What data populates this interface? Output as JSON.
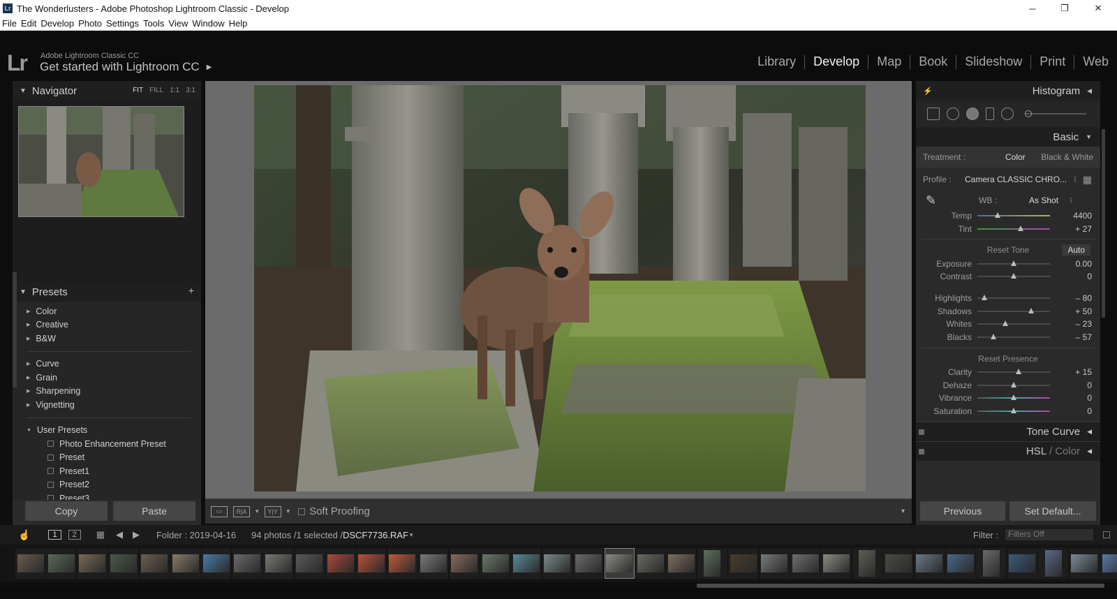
{
  "window": {
    "title": "The Wonderlusters - Adobe Photoshop Lightroom Classic - Develop",
    "app_icon": "Lr",
    "min": "─",
    "max": "❐",
    "close": "✕"
  },
  "menu": [
    "File",
    "Edit",
    "Develop",
    "Photo",
    "Settings",
    "Tools",
    "View",
    "Window",
    "Help"
  ],
  "identity": {
    "logo": "Lr",
    "sub": "Adobe Lightroom Classic CC",
    "main": "Get started with Lightroom CC",
    "arrow": "▶"
  },
  "modules": [
    "Library",
    "Develop",
    "Map",
    "Book",
    "Slideshow",
    "Print",
    "Web"
  ],
  "active_module": "Develop",
  "navigator": {
    "title": "Navigator",
    "options": [
      "FIT",
      "FILL",
      "1:1",
      "3:1"
    ],
    "active_option": "FIT"
  },
  "presets": {
    "title": "Presets",
    "add": "+",
    "groups_a": [
      "Color",
      "Creative",
      "B&W"
    ],
    "groups_b": [
      "Curve",
      "Grain",
      "Sharpening",
      "Vignetting"
    ],
    "user_group": "User Presets",
    "user_items": [
      "Photo Enhancement Preset",
      "Preset",
      "Preset1",
      "Preset2",
      "Preset3"
    ]
  },
  "left_buttons": {
    "copy": "Copy",
    "paste": "Paste"
  },
  "toolbar": {
    "soft_proofing": "Soft Proofing"
  },
  "right": {
    "histogram": "Histogram",
    "basic": "Basic",
    "treatment_label": "Treatment :",
    "treatment_color": "Color",
    "treatment_bw": "Black & White",
    "profile_label": "Profile :",
    "profile_value": "Camera CLASSIC CHRO...",
    "wb_label": "WB :",
    "wb_value": "As Shot",
    "reset_tone": "Reset Tone",
    "auto": "Auto",
    "reset_presence": "Reset Presence",
    "sliders": {
      "temp": {
        "label": "Temp",
        "value": "4400",
        "pos": 0.28
      },
      "tint": {
        "label": "Tint",
        "value": "+ 27",
        "pos": 0.6
      },
      "exposure": {
        "label": "Exposure",
        "value": "0.00",
        "pos": 0.5
      },
      "contrast": {
        "label": "Contrast",
        "value": "0",
        "pos": 0.5
      },
      "highlights": {
        "label": "Highlights",
        "value": "– 80",
        "pos": 0.1
      },
      "shadows": {
        "label": "Shadows",
        "value": "+ 50",
        "pos": 0.74
      },
      "whites": {
        "label": "Whites",
        "value": "– 23",
        "pos": 0.38
      },
      "blacks": {
        "label": "Blacks",
        "value": "– 57",
        "pos": 0.22
      },
      "clarity": {
        "label": "Clarity",
        "value": "+ 15",
        "pos": 0.57
      },
      "dehaze": {
        "label": "Dehaze",
        "value": "0",
        "pos": 0.5
      },
      "vibrance": {
        "label": "Vibrance",
        "value": "0",
        "pos": 0.5
      },
      "saturation": {
        "label": "Saturation",
        "value": "0",
        "pos": 0.5
      }
    },
    "tone_curve": "Tone Curve",
    "hsl": "HSL",
    "hsl_color": "Color",
    "hsl_sep": "/",
    "previous": "Previous",
    "set_default": "Set Default..."
  },
  "filmstrip": {
    "page1": "1",
    "page2": "2",
    "folder": "Folder : 2019-04-16",
    "count": "94 photos /1 selected /",
    "filename": "DSCF7736.RAF",
    "filter_label": "Filter :",
    "filter_value": "Filters Off"
  }
}
